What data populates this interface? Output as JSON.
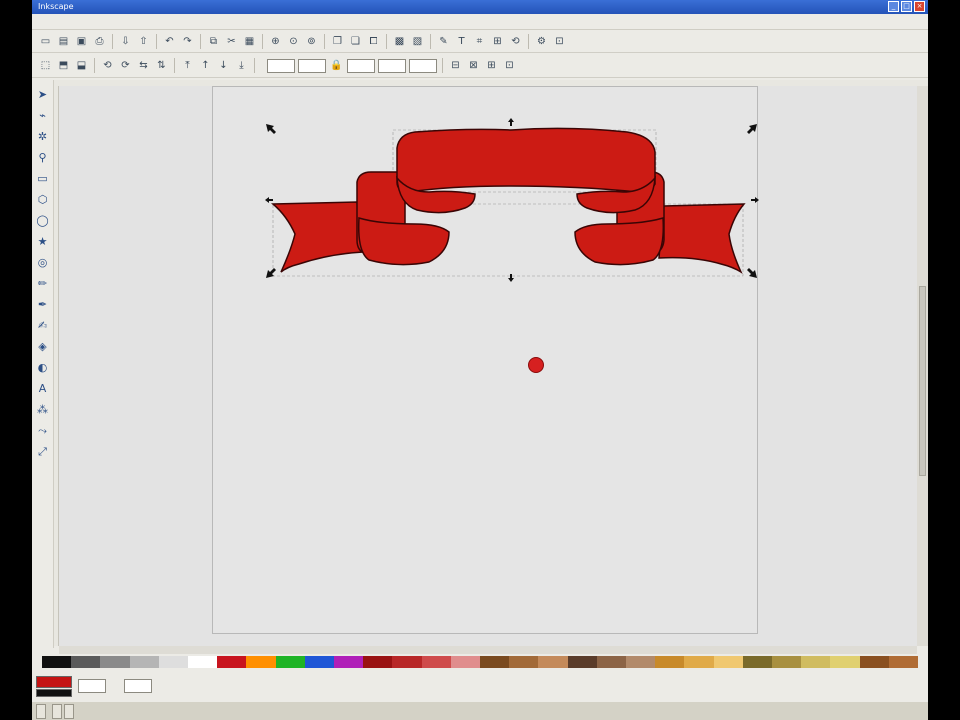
{
  "window": {
    "title": "Inkscape"
  },
  "menu": [],
  "toolbar2": {
    "font_size_label": "",
    "x_value": "",
    "y_value": "",
    "w_value": "",
    "h_value": "",
    "units_value": ""
  },
  "status": {
    "layer_value": "",
    "message": "",
    "coords": "",
    "zoom": ""
  },
  "taskbar": {
    "start_label": "",
    "tasks": [
      "",
      ""
    ]
  },
  "palette_colors": [
    "#111111",
    "#5a5a5a",
    "#8a8a8a",
    "#b5b5b5",
    "#dedede",
    "#ffffff",
    "#c8141e",
    "#ff8f00",
    "#1fb425",
    "#1f56d6",
    "#b01fb8",
    "#9a1212",
    "#b82727",
    "#cf4b4b",
    "#e08d8d",
    "#7a4a1f",
    "#a26a38",
    "#c48a5a",
    "#5a3c2a",
    "#8c6446",
    "#b28a6a",
    "#c88a2a",
    "#e0aa48",
    "#f0c870",
    "#7a6a2a",
    "#a89040",
    "#d0bc60",
    "#e0d070",
    "#8a5020",
    "#b06c34"
  ],
  "colors": {
    "banner_fill": "#cc1b14",
    "banner_stroke": "#3a0505",
    "selection_fill": "#c41414",
    "cursor": "#d62020"
  }
}
